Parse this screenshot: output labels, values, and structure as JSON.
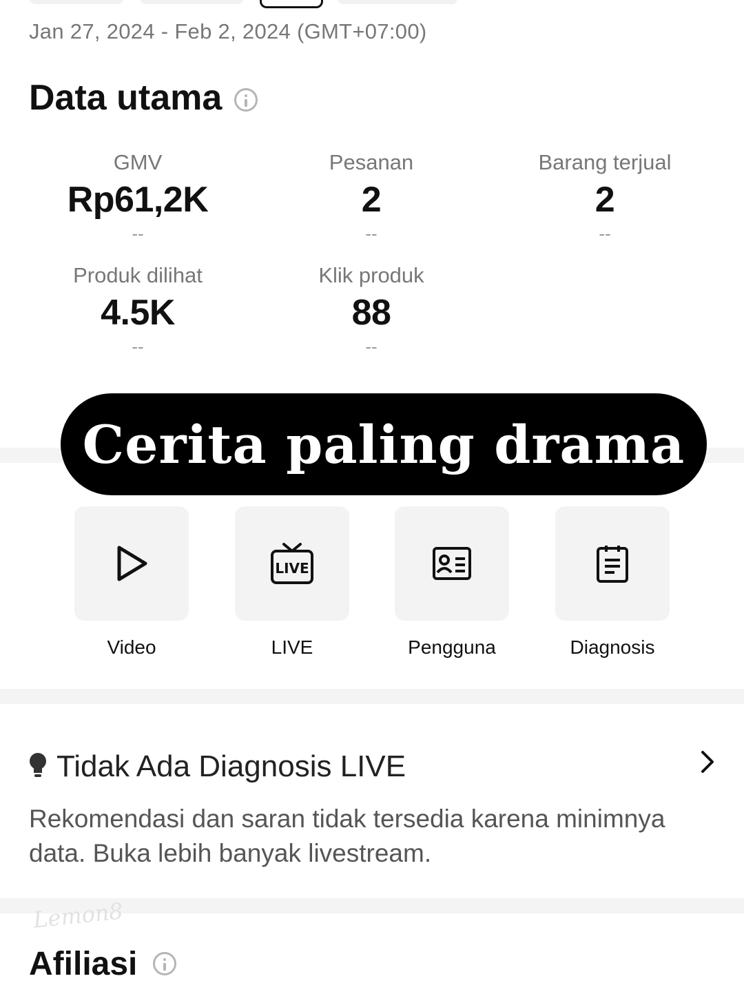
{
  "header": {
    "date_range": "Jan 27, 2024 - Feb 2, 2024 (GMT+07:00)"
  },
  "main_data": {
    "title": "Data utama",
    "metrics": [
      {
        "label": "GMV",
        "value": "Rp61,2K",
        "compare": "--"
      },
      {
        "label": "Pesanan",
        "value": "2",
        "compare": "--"
      },
      {
        "label": "Barang terjual",
        "value": "2",
        "compare": "--"
      },
      {
        "label": "Produk dilihat",
        "value": "4.5K",
        "compare": "--"
      },
      {
        "label": "Klik produk",
        "value": "88",
        "compare": "--"
      }
    ]
  },
  "overlay": {
    "caption": "Cerita paling drama"
  },
  "tools": [
    {
      "label": "Video",
      "icon": "play-icon"
    },
    {
      "label": "LIVE",
      "icon": "live-tv-icon"
    },
    {
      "label": "Pengguna",
      "icon": "id-card-icon"
    },
    {
      "label": "Diagnosis",
      "icon": "clipboard-icon"
    }
  ],
  "diagnosis": {
    "title": "Tidak Ada Diagnosis LIVE",
    "text": "Rekomendasi dan saran tidak tersedia karena minimnya data. Buka lebih banyak livestream."
  },
  "affiliate": {
    "title": "Afiliasi"
  },
  "watermark": {
    "text": "Lemon8"
  }
}
